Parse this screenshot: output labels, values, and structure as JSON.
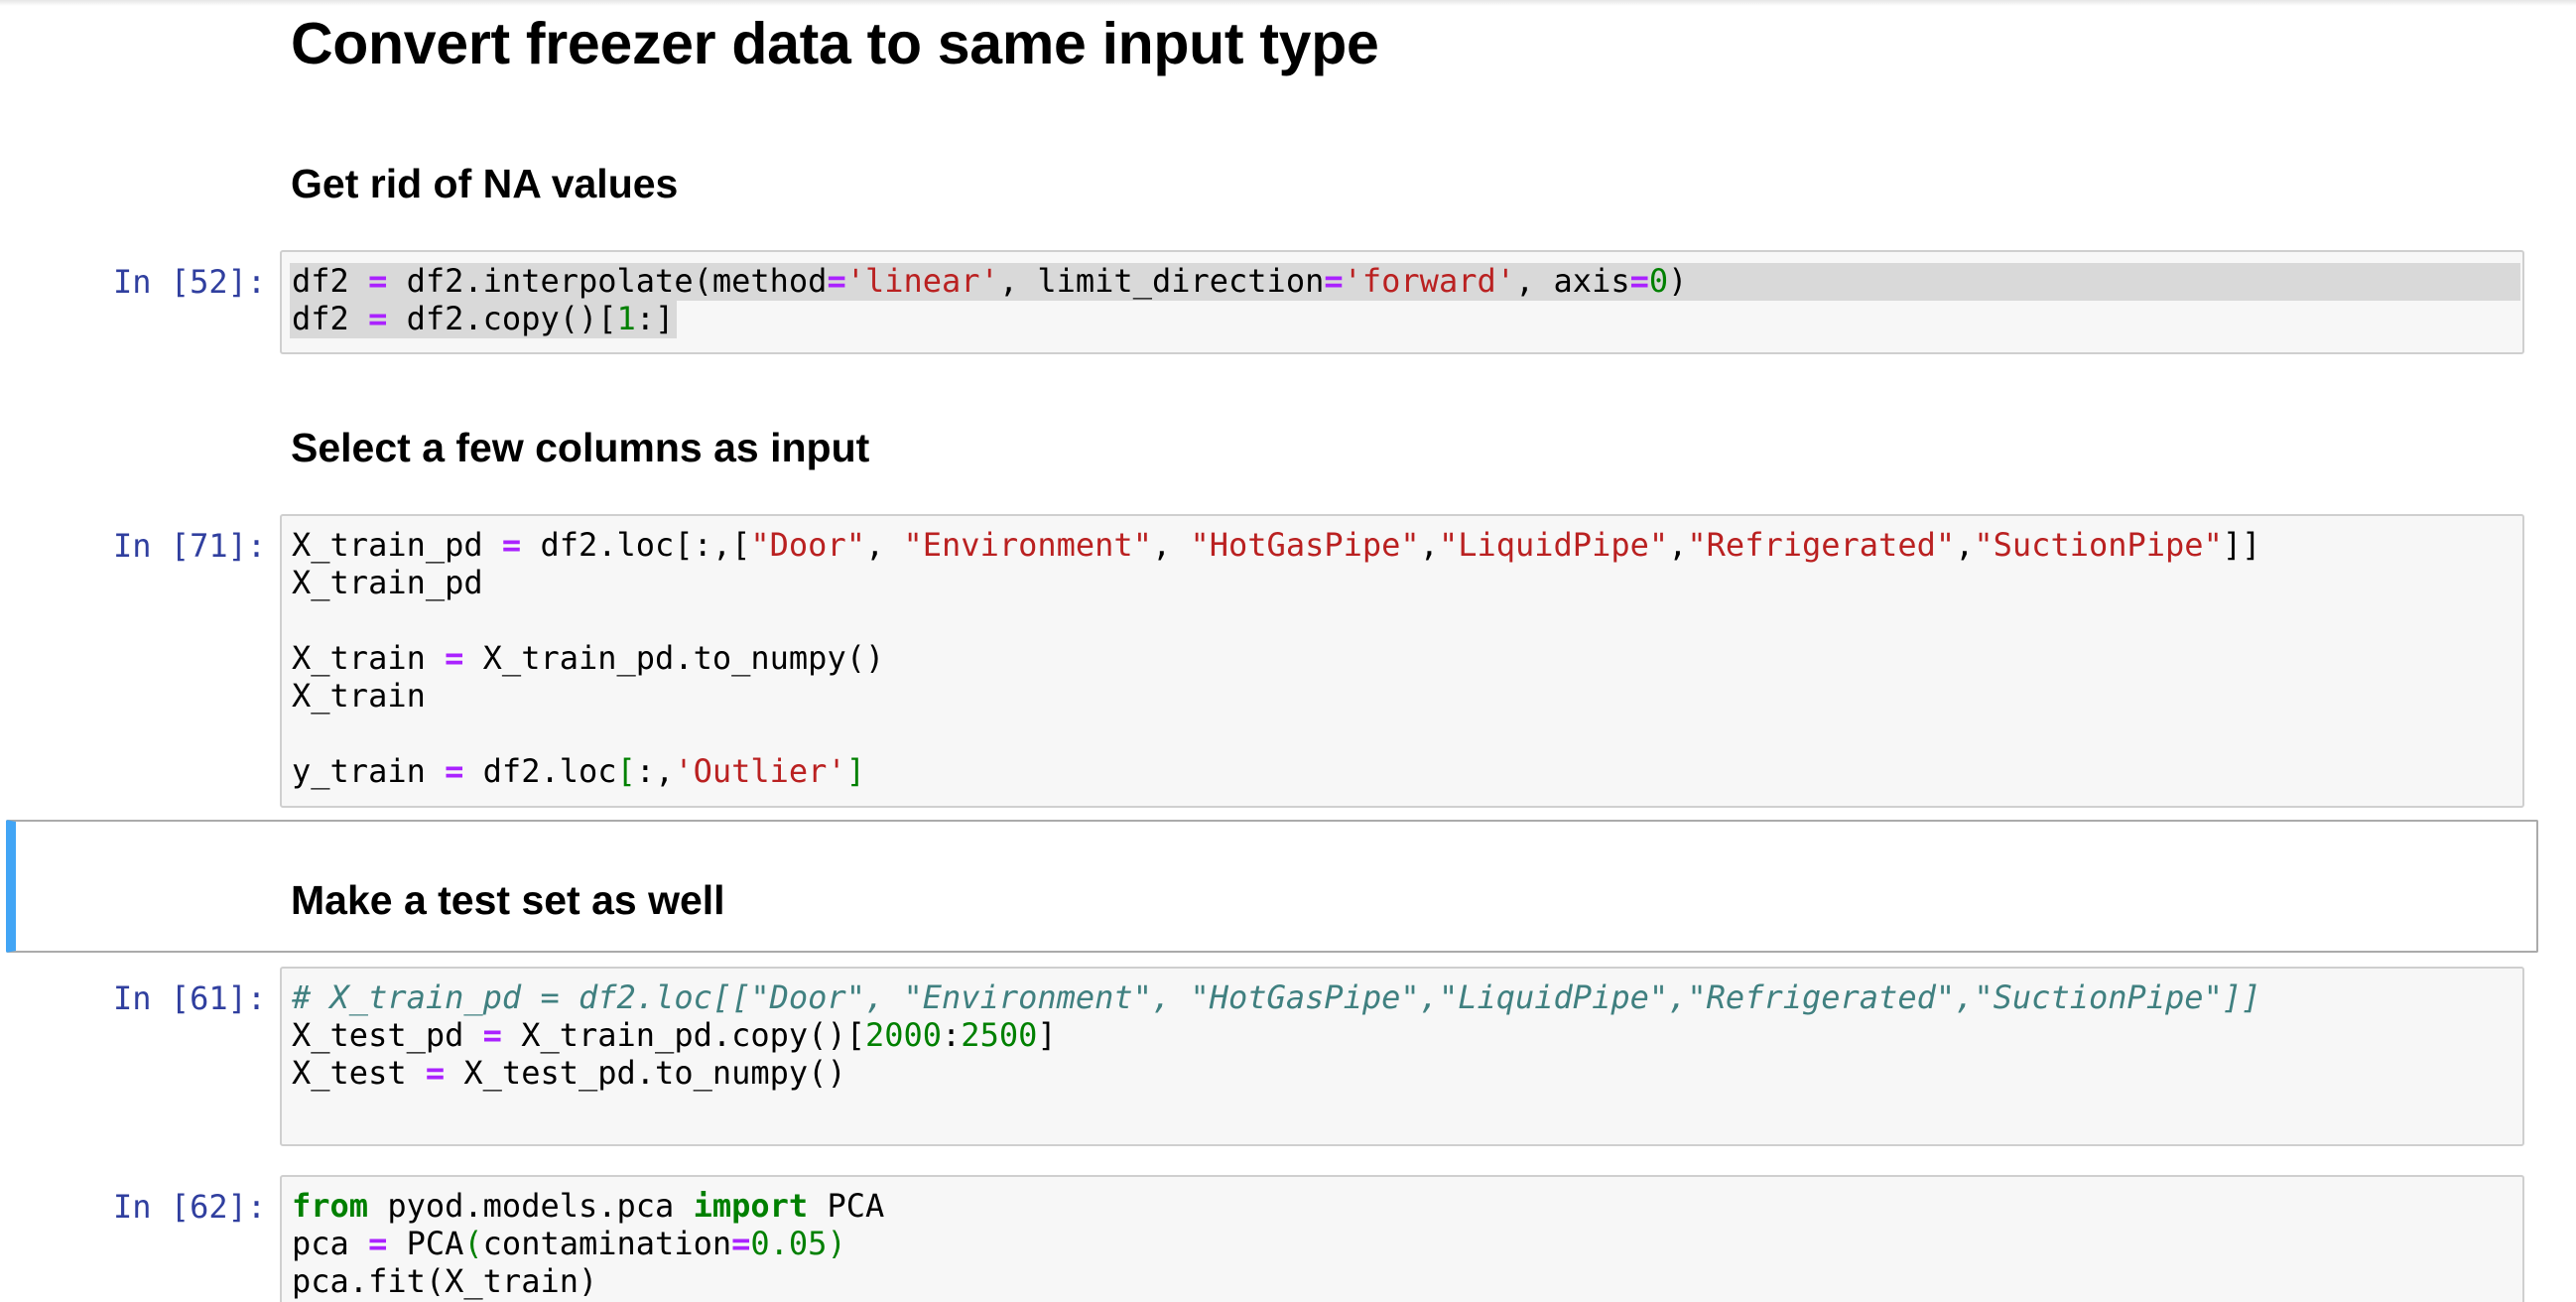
{
  "heading_main": "Convert freezer data to same input type",
  "heading_na": "Get rid of NA values",
  "heading_select": "Select a few columns as input",
  "heading_test": "Make a test set as well",
  "cells": [
    {
      "prompt": "In [52]:"
    },
    {
      "prompt": "In [71]:"
    },
    {
      "prompt": "In [61]:"
    },
    {
      "prompt": "In [62]:"
    }
  ],
  "code": {
    "cell52": [
      "df2 = df2.interpolate(method='linear', limit_direction='forward', axis=0)",
      "df2 = df2.copy()[1:]"
    ],
    "cell71": [
      "X_train_pd = df2.loc[:,[\"Door\", \"Environment\", \"HotGasPipe\",\"LiquidPipe\",\"Refrigerated\",\"SuctionPipe\"]]",
      "X_train_pd",
      "",
      "X_train = X_train_pd.to_numpy()",
      "X_train",
      "",
      "y_train = df2.loc[:,'Outlier']"
    ],
    "cell61": [
      "# X_train_pd = df2.loc[[\"Door\", \"Environment\", \"HotGasPipe\",\"LiquidPipe\",\"Refrigerated\",\"SuctionPipe\"]]",
      "X_test_pd = X_train_pd.copy()[2000:2500]",
      "X_test = X_test_pd.to_numpy()"
    ],
    "cell62": [
      "from pyod.models.pca import PCA",
      "pca = PCA(contamination=0.05)",
      "pca.fit(X_train)"
    ]
  },
  "colors": {
    "prompt": "#303f9f",
    "keyword": "#008000",
    "operator": "#aa22ff",
    "string": "#ba2121",
    "comment": "#408080",
    "selected_cell_bar": "#42a5f5"
  }
}
